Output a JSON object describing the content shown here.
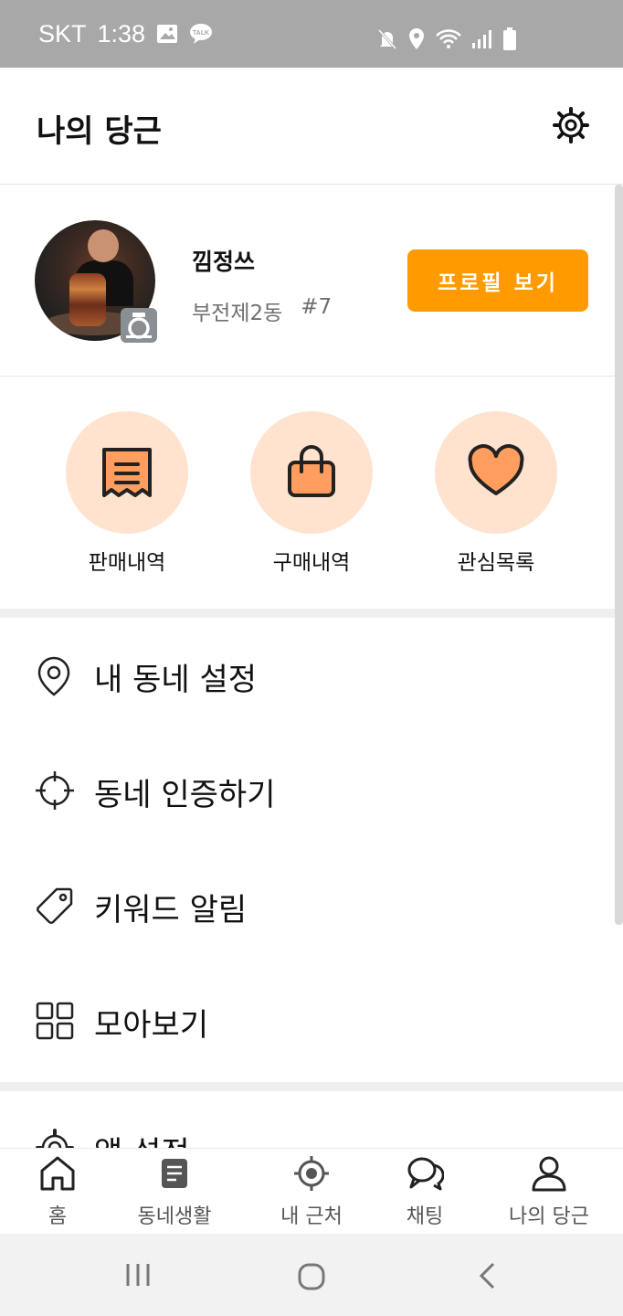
{
  "status_bar": {
    "carrier": "SKT",
    "time": "1:38",
    "icons": [
      "image-icon",
      "talk-icon",
      "mute-icon",
      "location-icon",
      "wifi-icon",
      "signal-icon",
      "battery-icon"
    ]
  },
  "header": {
    "title": "나의 당근",
    "settings_icon": "gear-icon"
  },
  "profile": {
    "nickname": "낌정쓰",
    "neighborhood": "부전제2동",
    "tag": "#7",
    "view_profile_label": "프로필 보기",
    "avatar_badge_icon": "camera-icon"
  },
  "quick_actions": [
    {
      "label": "판매내역",
      "icon": "receipt-icon"
    },
    {
      "label": "구매내역",
      "icon": "shopping-bag-icon"
    },
    {
      "label": "관심목록",
      "icon": "heart-icon"
    }
  ],
  "menu": [
    {
      "label": "내 동네 설정",
      "icon": "location-pin-icon"
    },
    {
      "label": "동네 인증하기",
      "icon": "crosshair-icon"
    },
    {
      "label": "키워드 알림",
      "icon": "tag-icon"
    },
    {
      "label": "모아보기",
      "icon": "grid-icon"
    },
    {
      "label": "앱 설정",
      "icon": "gear-icon"
    }
  ],
  "bottom_nav": [
    {
      "label": "홈",
      "icon": "home-icon"
    },
    {
      "label": "동네생활",
      "icon": "document-icon"
    },
    {
      "label": "내 근처",
      "icon": "target-icon"
    },
    {
      "label": "채팅",
      "icon": "chat-icon"
    },
    {
      "label": "나의 당근",
      "icon": "person-icon"
    }
  ],
  "colors": {
    "accent": "#ff9a00",
    "quick_action_bg": "#ffe3cf",
    "quick_action_fill": "#ff9e5e",
    "status_bar": "#a8a8a8"
  }
}
